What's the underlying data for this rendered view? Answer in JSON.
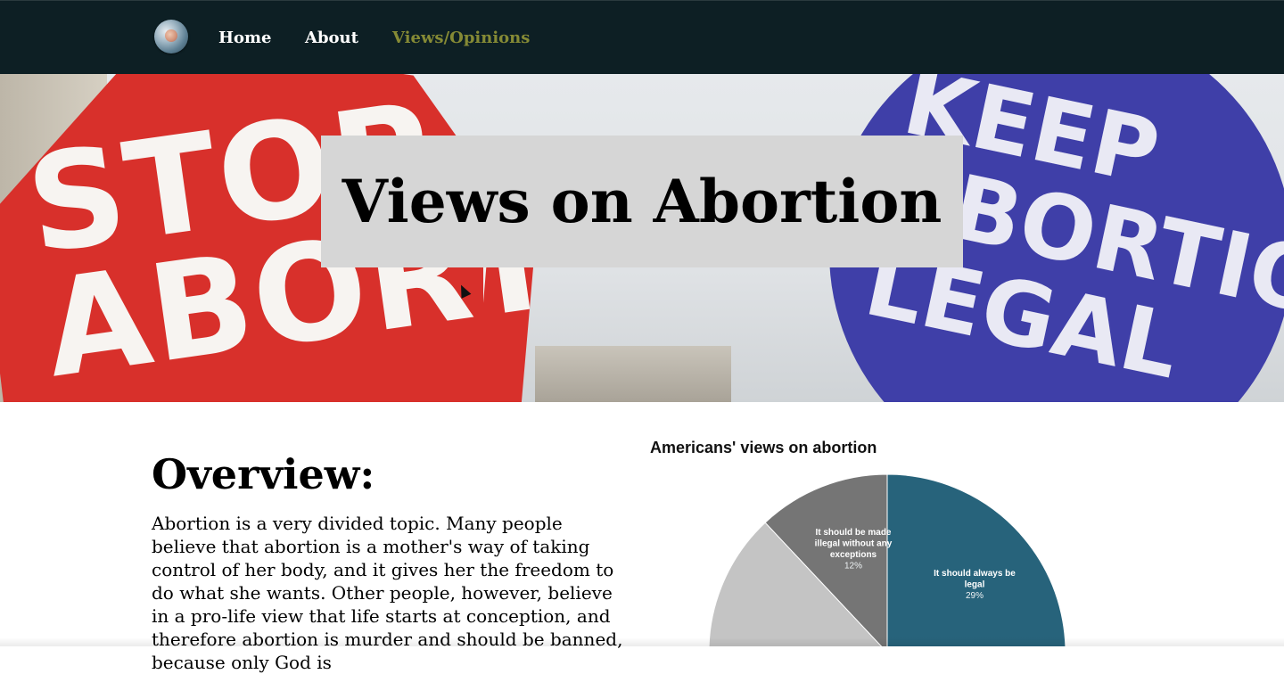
{
  "nav": {
    "items": [
      {
        "label": "Home"
      },
      {
        "label": "About"
      },
      {
        "label": "Views/Opinions"
      }
    ],
    "active_color": "#858a35",
    "background": "#0d1f24"
  },
  "hero": {
    "title": "Views on Abortion",
    "sign_left_text": "STOP ABORTION",
    "sign_right_text": "KEEP ABORTION LEGAL"
  },
  "overview": {
    "heading": "Overview:",
    "text": "Abortion is a very divided topic. Many people believe that abortion is a mother's way of taking control of her body, and it gives her the freedom to do what she wants. Other people, however, believe in a pro-life view that life starts at conception, and therefore abortion is murder and should be banned, because only God is"
  },
  "chart_data": {
    "type": "pie",
    "title": "Americans' views on abortion",
    "slices": [
      {
        "label": "It should always be legal",
        "value": 29,
        "pct_label": "29%",
        "color": "#27637b"
      },
      {
        "label": "It should be made illegal without any exceptions",
        "value": 12,
        "pct_label": "12%",
        "color": "#757575"
      },
      {
        "label": "",
        "value": 14,
        "pct_label": "",
        "color": "#c4c4c4"
      }
    ]
  }
}
